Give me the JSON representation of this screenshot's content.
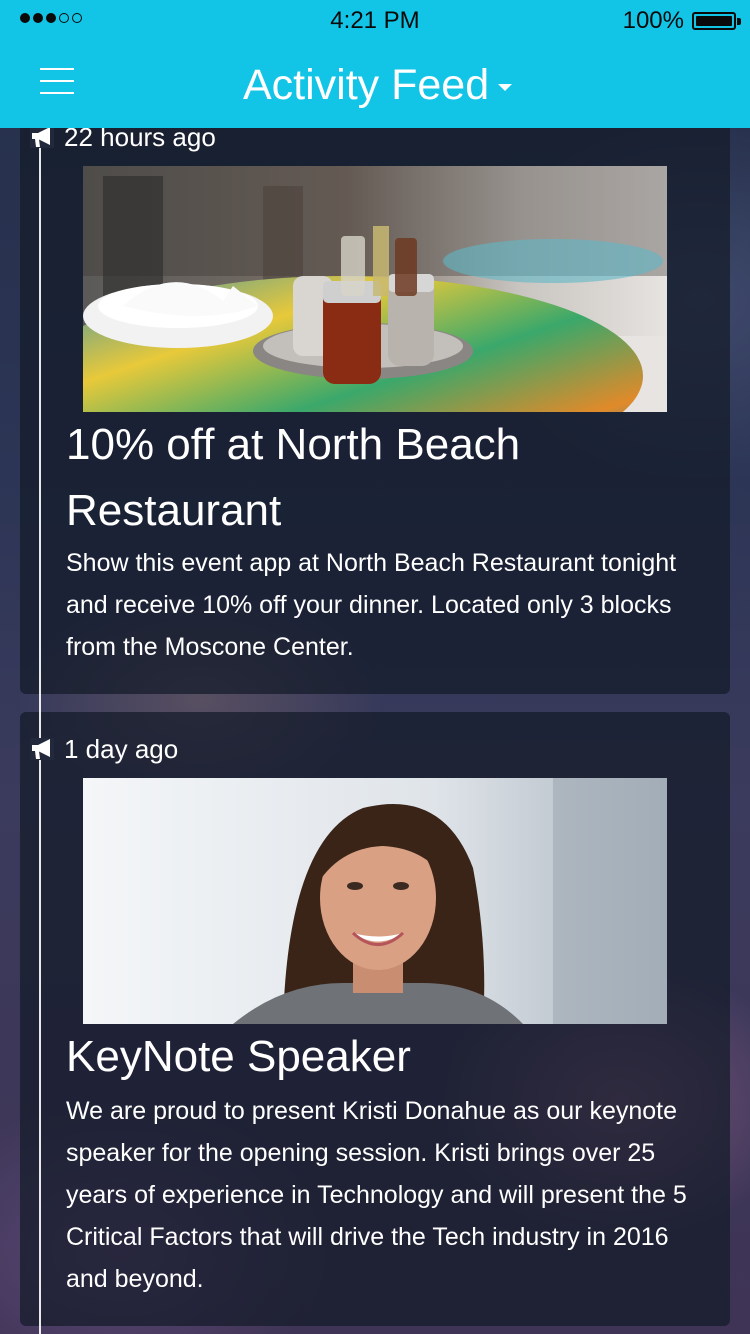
{
  "status_bar": {
    "time": "4:21 PM",
    "battery": "100%",
    "signal_bars_filled": 3,
    "signal_bars_total": 5
  },
  "nav": {
    "title": "Activity Feed",
    "menu_icon": "hamburger-menu-icon",
    "dropdown_icon": "caret-down-icon"
  },
  "colors": {
    "header": "#12c4e6",
    "text": "#ffffff"
  },
  "feed": [
    {
      "time": "22 hours ago",
      "icon": "megaphone-icon",
      "image": "restaurant-table-photo",
      "title": "10% off at North Beach Restaurant",
      "body": "Show this event app at North Beach Restaurant tonight and receive 10% off your dinner. Located only 3 blocks from the Moscone Center."
    },
    {
      "time": "1 day ago",
      "icon": "megaphone-icon",
      "image": "speaker-portrait-photo",
      "title": "KeyNote Speaker",
      "body": "We are proud to present Kristi Donahue as our keynote speaker for the opening session. Kristi brings over 25 years of experience in Technology and will present the 5 Critical Factors that will drive the Tech industry in 2016 and beyond."
    }
  ]
}
